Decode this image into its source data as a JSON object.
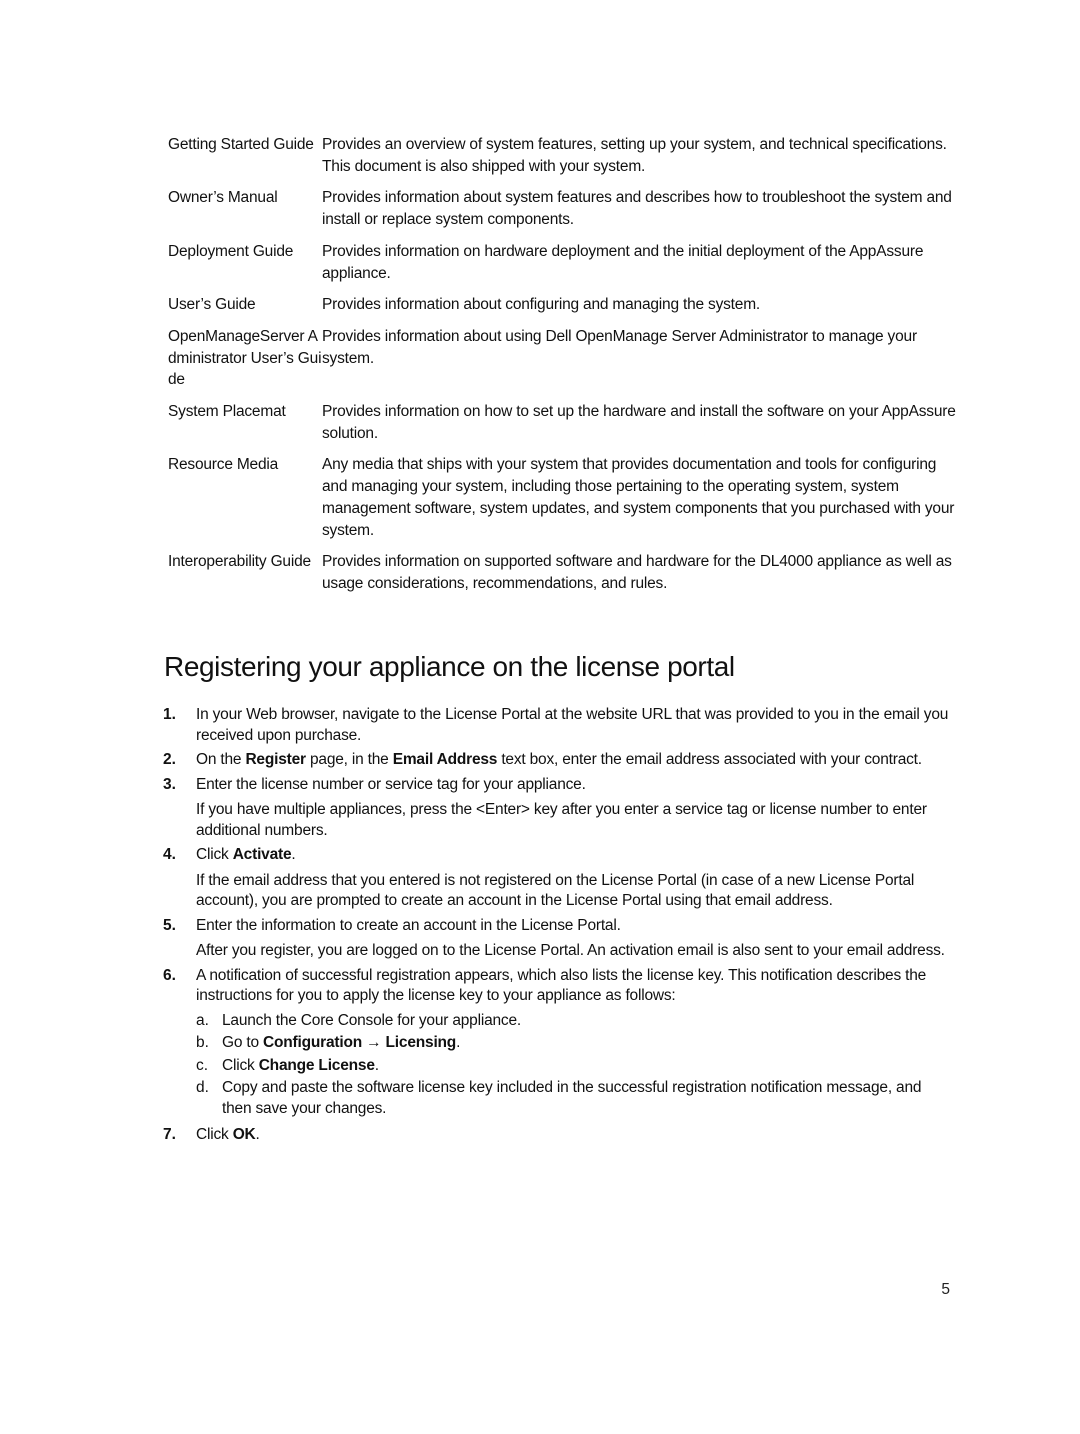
{
  "documents": [
    {
      "name": "Getting Started Guide",
      "description": "Provides an overview of system features, setting up your system, and technical specifications. This document is also shipped with your system."
    },
    {
      "name": "Owner’s Manual",
      "description": "Provides information about system features and describes how to troubleshoot the system and install or replace system components."
    },
    {
      "name": "Deployment Guide",
      "description": "Provides information on hardware deployment and the initial deployment of the AppAssure appliance."
    },
    {
      "name": "User’s Guide",
      "description": "Provides information about configuring and managing the system."
    },
    {
      "name": "OpenManageServer Administrator User’s Guide",
      "description": "Provides information about using Dell OpenManage Server Administrator to manage your system."
    },
    {
      "name": "System Placemat",
      "description": "Provides information on how to set up the hardware and install the software on your AppAssure solution."
    },
    {
      "name": "Resource Media",
      "description": "Any media that ships with your system that provides documentation and tools for configuring and managing your system, including those pertaining to the operating system, system management software, system updates, and system components that you purchased with your system."
    },
    {
      "name": "Interoperability Guide",
      "description": "Provides information on supported software and hardware for the DL4000 appliance as well as usage considerations, recommendations, and rules."
    }
  ],
  "section": {
    "title": "Registering your appliance on the license portal",
    "steps": [
      {
        "number": "1.",
        "text": "In your Web browser, navigate to the License Portal at the website URL that was provided to you in the email you received upon purchase."
      },
      {
        "number": "2.",
        "parts": [
          "On the ",
          "Register",
          " page, in the ",
          "Email Address",
          " text box, enter the email address associated with your contract."
        ]
      },
      {
        "number": "3.",
        "text": "Enter the license number or service tag for your appliance.",
        "note": "If you have multiple appliances, press the <Enter> key after you enter a service tag or license number to enter additional numbers."
      },
      {
        "number": "4.",
        "parts": [
          "Click ",
          "Activate",
          "."
        ],
        "note": "If the email address that you entered is not registered on the License Portal (in case of a new License Portal account), you are prompted to create an account in the License Portal using that email address."
      },
      {
        "number": "5.",
        "text": "Enter the information to create an account in the License Portal.",
        "note": "After you register, you are logged on to the License Portal. An activation email is also sent to your email address."
      },
      {
        "number": "6.",
        "text": "A notification of successful registration appears, which also lists the license key. This notification describes the instructions for you to apply the license key to your appliance as follows:",
        "substeps": [
          {
            "letter": "a.",
            "text": "Launch the Core Console for your appliance."
          },
          {
            "letter": "b.",
            "parts": [
              "Go to ",
              "Configuration → Licensing",
              "."
            ]
          },
          {
            "letter": "c.",
            "parts": [
              "Click ",
              "Change License",
              "."
            ]
          },
          {
            "letter": "d.",
            "text": "Copy and paste the software license key included in the successful registration notification message, and then save your changes."
          }
        ]
      },
      {
        "number": "7.",
        "parts": [
          "Click ",
          "OK",
          "."
        ]
      }
    ]
  },
  "footer": {
    "page_number": "5"
  }
}
